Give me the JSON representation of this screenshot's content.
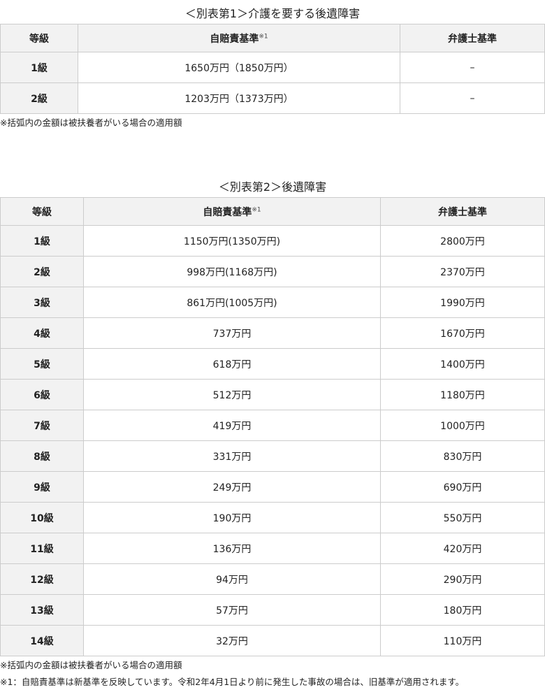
{
  "table1": {
    "caption": "＜別表第1＞介護を要する後遺障害",
    "headers": {
      "grade": "等級",
      "jibaiseki": "自賠責基準",
      "jibaiseki_sup": "※1",
      "bengoshi": "弁護士基準"
    },
    "rows": [
      {
        "grade": "1級",
        "jibaiseki": "1650万円（1850万円）",
        "bengoshi": "–"
      },
      {
        "grade": "2級",
        "jibaiseki": "1203万円（1373万円）",
        "bengoshi": "–"
      }
    ],
    "note": "※括弧内の金額は被扶養者がいる場合の適用額"
  },
  "table2": {
    "caption": "＜別表第2＞後遺障害",
    "headers": {
      "grade": "等級",
      "jibaiseki": "自賠責基準",
      "jibaiseki_sup": "※1",
      "bengoshi": "弁護士基準"
    },
    "rows": [
      {
        "grade": "1級",
        "jibaiseki": "1150万円(1350万円)",
        "bengoshi": "2800万円"
      },
      {
        "grade": "2級",
        "jibaiseki": "998万円(1168万円)",
        "bengoshi": "2370万円"
      },
      {
        "grade": "3級",
        "jibaiseki": "861万円(1005万円)",
        "bengoshi": "1990万円"
      },
      {
        "grade": "4級",
        "jibaiseki": "737万円",
        "bengoshi": "1670万円"
      },
      {
        "grade": "5級",
        "jibaiseki": "618万円",
        "bengoshi": "1400万円"
      },
      {
        "grade": "6級",
        "jibaiseki": "512万円",
        "bengoshi": "1180万円"
      },
      {
        "grade": "7級",
        "jibaiseki": "419万円",
        "bengoshi": "1000万円"
      },
      {
        "grade": "8級",
        "jibaiseki": "331万円",
        "bengoshi": "830万円"
      },
      {
        "grade": "9級",
        "jibaiseki": "249万円",
        "bengoshi": "690万円"
      },
      {
        "grade": "10級",
        "jibaiseki": "190万円",
        "bengoshi": "550万円"
      },
      {
        "grade": "11級",
        "jibaiseki": "136万円",
        "bengoshi": "420万円"
      },
      {
        "grade": "12級",
        "jibaiseki": "94万円",
        "bengoshi": "290万円"
      },
      {
        "grade": "13級",
        "jibaiseki": "57万円",
        "bengoshi": "180万円"
      },
      {
        "grade": "14級",
        "jibaiseki": "32万円",
        "bengoshi": "110万円"
      }
    ],
    "notes": [
      "※括弧内の金額は被扶養者がいる場合の適用額",
      "※1：自賠責基準は新基準を反映しています。令和2年4月1日より前に発生した事故の場合は、旧基準が適用されます。"
    ]
  },
  "colors": {
    "header_bg": "#f2f2f2",
    "border": "#cccccc",
    "text": "#222222"
  }
}
